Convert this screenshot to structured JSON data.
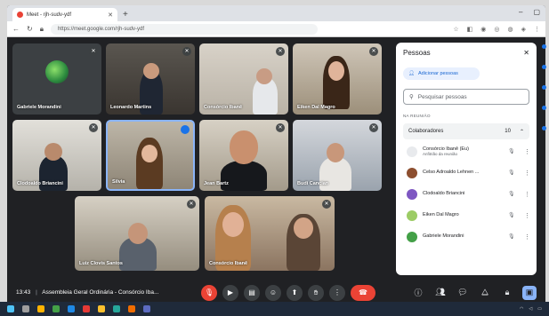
{
  "browser": {
    "tab_title": "Meet - rjh-sudv-ydf",
    "new_tab": "+",
    "url": "https://meet.google.com/rjh-sudv-ydf"
  },
  "participants_tiles": [
    {
      "name": "Gabriele Morandini"
    },
    {
      "name": "Leonardo Martins"
    },
    {
      "name": "Consórcio Ibanê"
    },
    {
      "name": "Eiken Dal Magro"
    },
    {
      "name": "Clodoaldo Briancini"
    },
    {
      "name": "Silvia"
    },
    {
      "name": "Jean Bartz"
    },
    {
      "name": "Budi Cancian"
    },
    {
      "name": "Luiz Clovis Santos"
    },
    {
      "name": "Consórcio Ibanê"
    }
  ],
  "bottombar": {
    "time": "13:43",
    "meeting_title": "Assembleia Geral Ordinária - Consórcio Iba..."
  },
  "panel": {
    "title": "Pessoas",
    "add_label": "Adicionar pessoas",
    "search_placeholder": "Pesquisar pessoas",
    "section_label": "NA REUNIÃO",
    "group_label": "Colaboradores",
    "group_count": "10",
    "people": [
      {
        "name": "Consórcio Ibanê (Eu)",
        "sub": "Anfitrião da reunião",
        "color": "#e8eaed"
      },
      {
        "name": "Celso Adroaldo Lehnen ...",
        "sub": "",
        "color": "#8d4f2f"
      },
      {
        "name": "Clodoaldo Briancini",
        "sub": "",
        "color": "#7e57c2"
      },
      {
        "name": "Eiken Dal Magro",
        "sub": "",
        "color": "#9ccc65"
      },
      {
        "name": "Gabriele Morandini",
        "sub": "",
        "color": "#43a047"
      }
    ]
  }
}
